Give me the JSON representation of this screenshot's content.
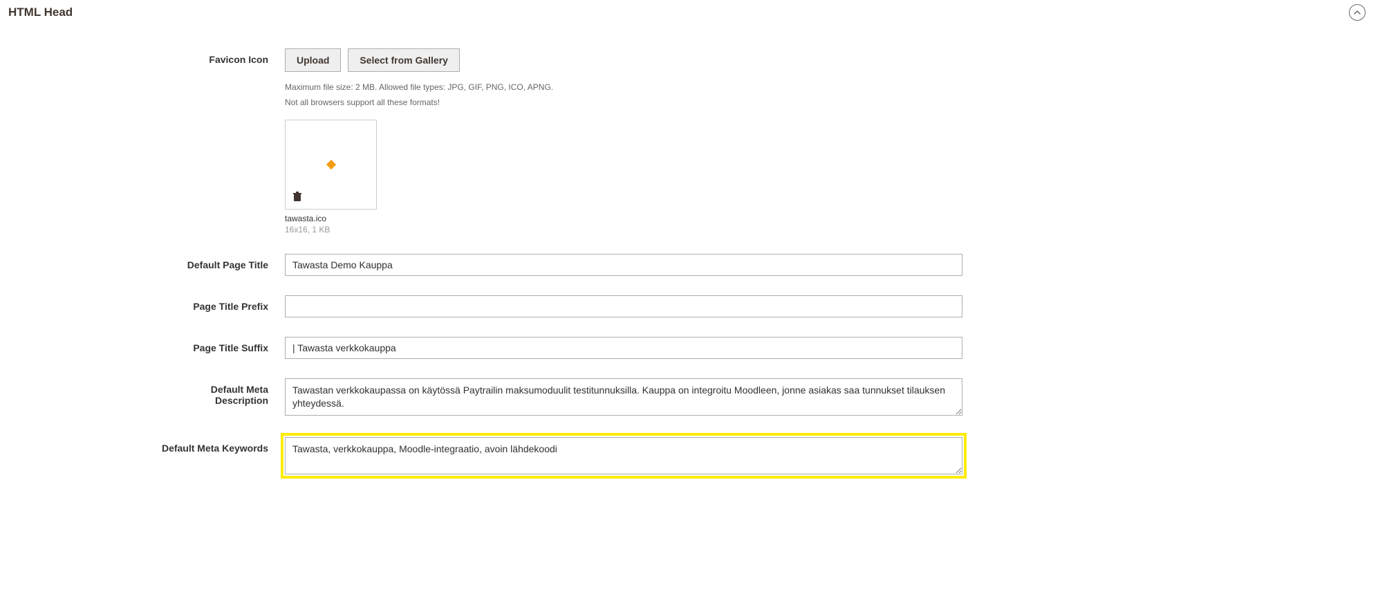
{
  "section": {
    "title": "HTML Head",
    "labels": {
      "favicon": "Favicon Icon",
      "default_page_title": "Default Page Title",
      "page_title_prefix": "Page Title Prefix",
      "page_title_suffix": "Page Title Suffix",
      "default_meta_description": "Default Meta Description",
      "default_meta_keywords": "Default Meta Keywords"
    },
    "buttons": {
      "upload": "Upload",
      "select_from_gallery": "Select from Gallery"
    },
    "notes": {
      "line1": "Maximum file size: 2 MB. Allowed file types: JPG, GIF, PNG, ICO, APNG.",
      "line2": "Not all browsers support all these formats!"
    },
    "favicon_file": {
      "name": "tawasta.ico",
      "meta": "16x16, 1 KB"
    },
    "values": {
      "default_page_title": "Tawasta Demo Kauppa",
      "page_title_prefix": "",
      "page_title_suffix": "| Tawasta verkkokauppa",
      "default_meta_description": "Tawastan verkkokaupassa on käytössä Paytrailin maksumoduulit testitunnuksilla. Kauppa on integroitu Moodleen, jonne asiakas saa tunnukset tilauksen yhteydessä.",
      "default_meta_keywords": "Tawasta, verkkokauppa, Moodle-integraatio, avoin lähdekoodi"
    }
  }
}
